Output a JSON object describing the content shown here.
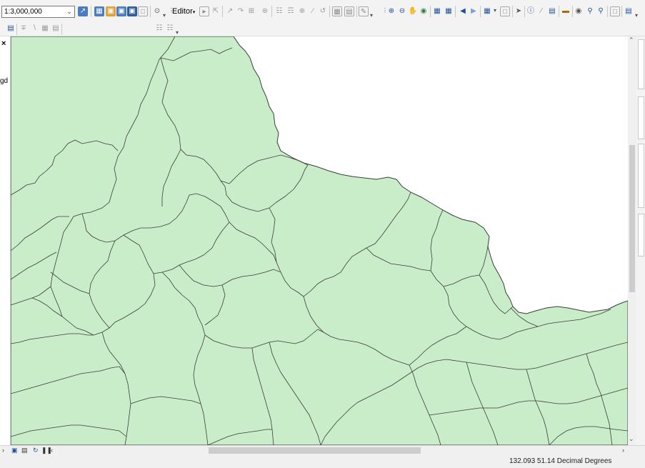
{
  "toolbar": {
    "scale_value": "1:3,000,000",
    "editor_label": "Editor"
  },
  "map": {
    "land_color": "#c8edc8",
    "border_color": "#3c3c3c",
    "background_color": "#ffffff"
  },
  "left_panel": {
    "visible_text_fragment": "gd"
  },
  "status": {
    "coordinates": "132.093  51.14 Decimal Degrees"
  },
  "icons": [
    "measure-icon",
    "table-icon",
    "catalog-icon",
    "arctoolbox-icon",
    "python-icon",
    "python-window-icon",
    "search-window-icon",
    "editor-dropdown-icon",
    "edit-tool-icon",
    "sketch-icon",
    "zoom-in-icon",
    "zoom-out-icon",
    "pan-icon",
    "full-extent-icon",
    "back-icon",
    "forward-icon",
    "select-icon",
    "identify-icon",
    "find-icon",
    "go-to-xy-icon",
    "html-popup-icon",
    "close-icon",
    "layout-view-icon",
    "data-view-icon",
    "refresh-icon",
    "pause-icon"
  ]
}
